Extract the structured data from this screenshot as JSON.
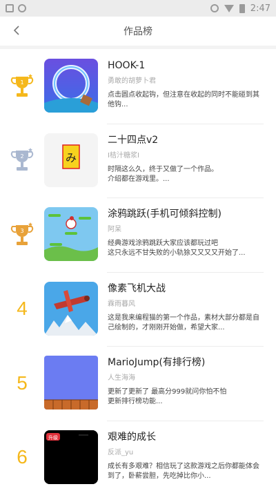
{
  "status": {
    "time": "2:47"
  },
  "header": {
    "title": "作品榜",
    "back_icon": "chevron-left-icon"
  },
  "colors": {
    "gold": "#f5b81c",
    "silver": "#aab8d0",
    "bronze": "#e8a23a"
  },
  "items": [
    {
      "rank": "1",
      "rank_style": "trophy-gold",
      "title": "HOOK-1",
      "author": "勇敢的胡萝卜君",
      "desc": "点击圆点收起钩，但注意在收起的同时不能碰到其他钩..."
    },
    {
      "rank": "2",
      "rank_style": "trophy-silver",
      "title": "二十四点v2",
      "author": "I桔汁糖浆I",
      "desc": "时隔这么久，终于又做了一个作品。\n介绍都在游戏里。..."
    },
    {
      "rank": "3",
      "rank_style": "trophy-bronze",
      "title": "涂鸦跳跃(手机可倾斜控制)",
      "author": "阿呆",
      "desc": "经典游戏涂鸦跳跃大家应该都玩过吧\n这只永远不甘失败的小轨狳又又又又开始了..."
    },
    {
      "rank": "4",
      "rank_style": "number",
      "title": "像素飞机大战",
      "author": "霖雨暮风",
      "desc": "这是我来编程猫的第一个作品，素材大部分都是自己绘制的，才刚刚开始做，希望大家..."
    },
    {
      "rank": "5",
      "rank_style": "number",
      "title": "MarioJump(有排行榜)",
      "author": "人生海海",
      "desc": "更新了更新了 最高分999就问你怕不怕\n更新排行榜功能..."
    },
    {
      "rank": "6",
      "rank_style": "number",
      "title": "艰难的成长",
      "author": "反派_yu",
      "desc": "成长有多艰难？相信玩了这款游戏之后你都能体会到了，卧薪尝胆，先吃掉比你小..."
    }
  ],
  "thumb_texts": {
    "item2_glyph": "み",
    "item6_badge": "升级"
  }
}
